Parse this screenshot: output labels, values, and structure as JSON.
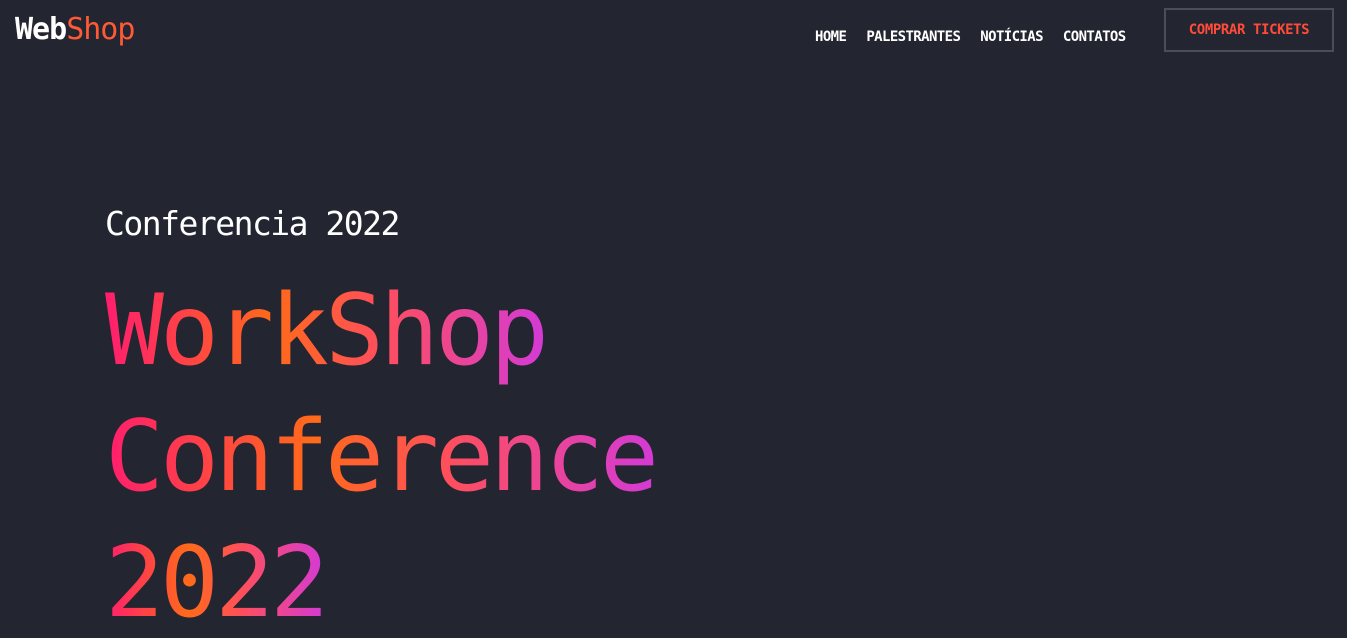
{
  "header": {
    "logo_part1": "Web",
    "logo_part2": "Shop",
    "nav": [
      {
        "label": "HOME"
      },
      {
        "label": "PALESTRANTES"
      },
      {
        "label": "NOTÍCIAS"
      },
      {
        "label": "CONTATOS"
      }
    ],
    "cta_label": "COMPRAR TICKETS"
  },
  "hero": {
    "subtitle": "Conferencia 2022",
    "headline_lines": [
      "WorkShop",
      "Conference",
      "2022"
    ]
  },
  "colors": {
    "background": "#232531",
    "accent": "#ff5a36",
    "gradient": [
      "#ff1e6e",
      "#ff6a1a",
      "#ff4f5b",
      "#d43ad6"
    ]
  }
}
